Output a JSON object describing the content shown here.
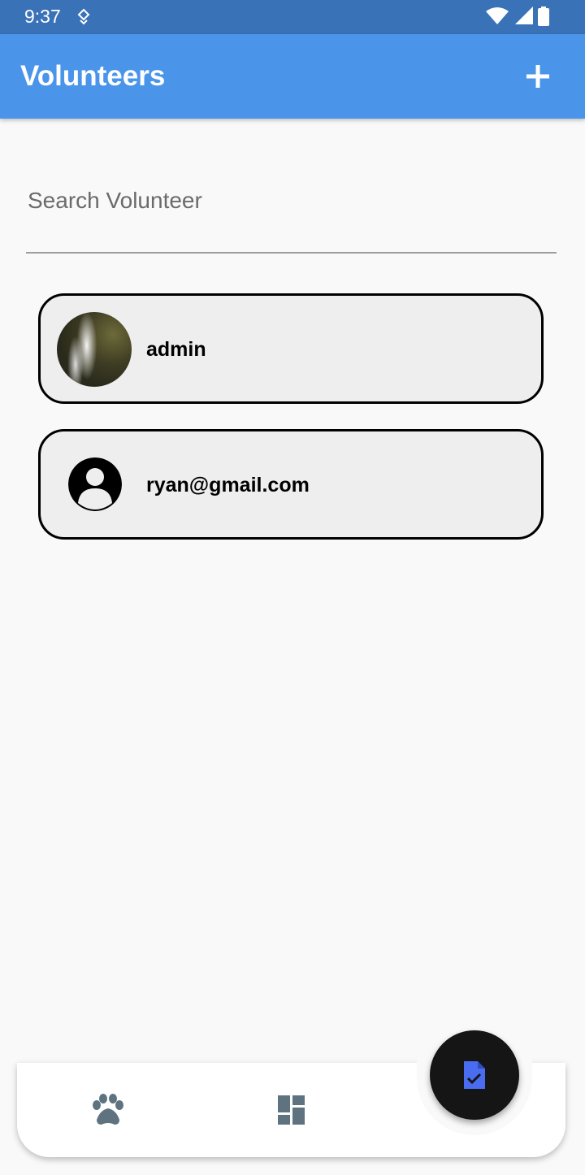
{
  "status_bar": {
    "time": "9:37",
    "left_icon": "data-saver-icon",
    "right_icons": [
      "wifi-icon",
      "signal-icon",
      "battery-icon"
    ]
  },
  "app_bar": {
    "title": "Volunteers",
    "action_icon": "add-icon",
    "color": "#4a95ea"
  },
  "search": {
    "placeholder": "Search Volunteer",
    "value": ""
  },
  "volunteers": [
    {
      "name": "admin",
      "avatar": "photo-waterfall"
    },
    {
      "name": "ryan@gmail.com",
      "avatar": "default-person-icon"
    }
  ],
  "bottom_nav": {
    "items": [
      {
        "icon": "paw-icon"
      },
      {
        "icon": "dashboard-icon"
      }
    ],
    "fab_icon": "task-document-icon"
  },
  "colors": {
    "status_bar": "#3a72b8",
    "accent": "#4a95ea",
    "fab": "#151515",
    "fab_icon": "#4a6cf0",
    "nav_icon": "#5f7280"
  }
}
